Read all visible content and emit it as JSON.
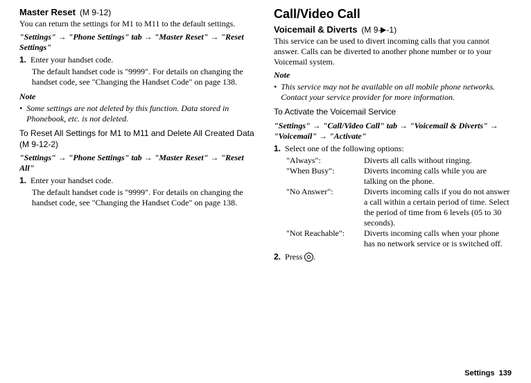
{
  "left": {
    "masterReset": {
      "title": "Master Reset",
      "menuRef": "(M 9-12)",
      "intro": "You can return the settings for M1 to M11 to the default settings.",
      "navpath": "\"Settings\" → \"Phone Settings\" tab → \"Master Reset\" → \"Reset Settings\"",
      "step1": "Enter your handset code.",
      "step1sub": "The default handset code is \"9999\". For details on changing the handset code, see \"Changing the Handset Code\" on page 138.",
      "noteLabel": "Note",
      "noteItem": "Some settings are not deleted by this function. Data stored in Phonebook, etc. is not deleted."
    },
    "resetAll": {
      "title": "To Reset All Settings for M1 to M11 and Delete All Created Data",
      "menuRef": "(M 9-12-2)",
      "navpath": "\"Settings\" → \"Phone Settings\" tab → \"Master Reset\" → \"Reset All\"",
      "step1": "Enter your handset code.",
      "step1sub": "The default handset code is \"9999\". For details on changing the handset code, see \"Changing the Handset Code\" on page 138."
    }
  },
  "right": {
    "section": "Call/Video Call",
    "vm": {
      "title": "Voicemail & Diverts",
      "menuRefPrefix": "(M 9-",
      "menuRefSuffix": "-1)",
      "intro": "This service can be used to divert incoming calls that you cannot answer. Calls can be diverted to another phone number or to your Voicemail system.",
      "noteLabel": "Note",
      "noteItem": "This service may not be available on all mobile phone networks. Contact your service provider for more information.",
      "subhead": "To Activate the Voicemail Service",
      "navpath": "\"Settings\" → \"Call/Video Call\" tab → \"Voicemail & Diverts\" → \"Voicemail\" → \"Activate\"",
      "step1": "Select one of the following options:",
      "options": [
        {
          "k": "\"Always\":",
          "v": "Diverts all calls without ringing."
        },
        {
          "k": "\"When Busy\":",
          "v": "Diverts incoming calls while you are talking on the phone."
        },
        {
          "k": "\"No Answer\":",
          "v": "Diverts incoming calls if you do not answer a call within a certain period of time. Select the period of time from 6 levels (05 to 30 seconds)."
        },
        {
          "k": "\"Not Reachable\":",
          "v": "Diverts incoming calls when your phone has no network service or is switched off."
        }
      ],
      "step2prefix": "Press ",
      "step2suffix": "."
    }
  },
  "footer": {
    "label": "Settings",
    "page": "139"
  }
}
